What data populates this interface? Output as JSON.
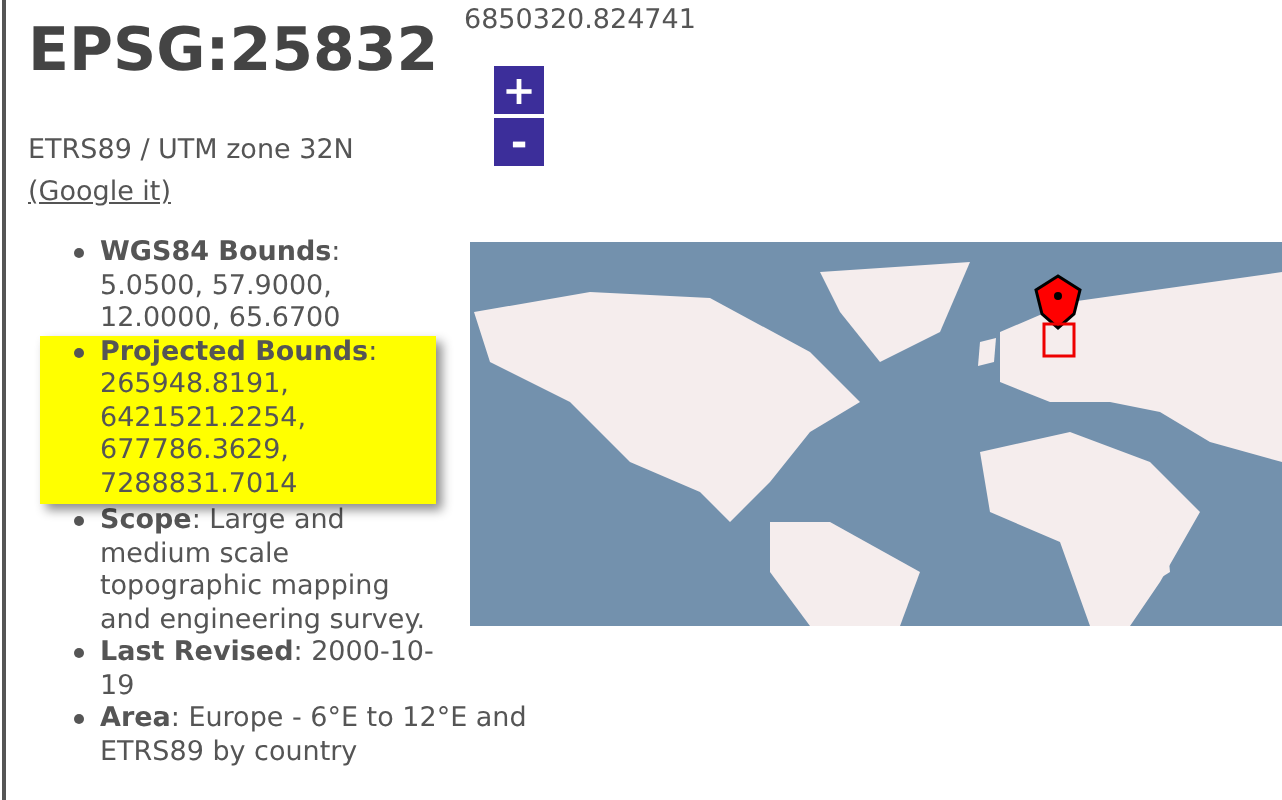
{
  "title": "EPSG:25832",
  "subtitle": "ETRS89 / UTM zone 32N",
  "google_link": "(Google it)",
  "top_text": "6850320.824741",
  "zoom_buttons": [
    "+",
    "-"
  ],
  "details": [
    {
      "text": "**WGS84 Bounds**: 5.0500, 57.9000, 12.0000, 65.6700",
      "highlighted": false
    },
    {
      "text": "**Projected Bounds**: 265948.8191, 6421521.2254, 677786.3629, 7288831.7014",
      "highlighted": true
    },
    {
      "text": "**Scope**: Large and medium scale topographic mapping and engineering survey.",
      "highlighted": false
    },
    {
      "text": "**Last Revised**: 2000-10-19",
      "highlighted": false
    },
    {
      "text": "**Area**: Europe - 6°E to 12°E and ETRS89 by country",
      "highlighted": false
    }
  ]
}
